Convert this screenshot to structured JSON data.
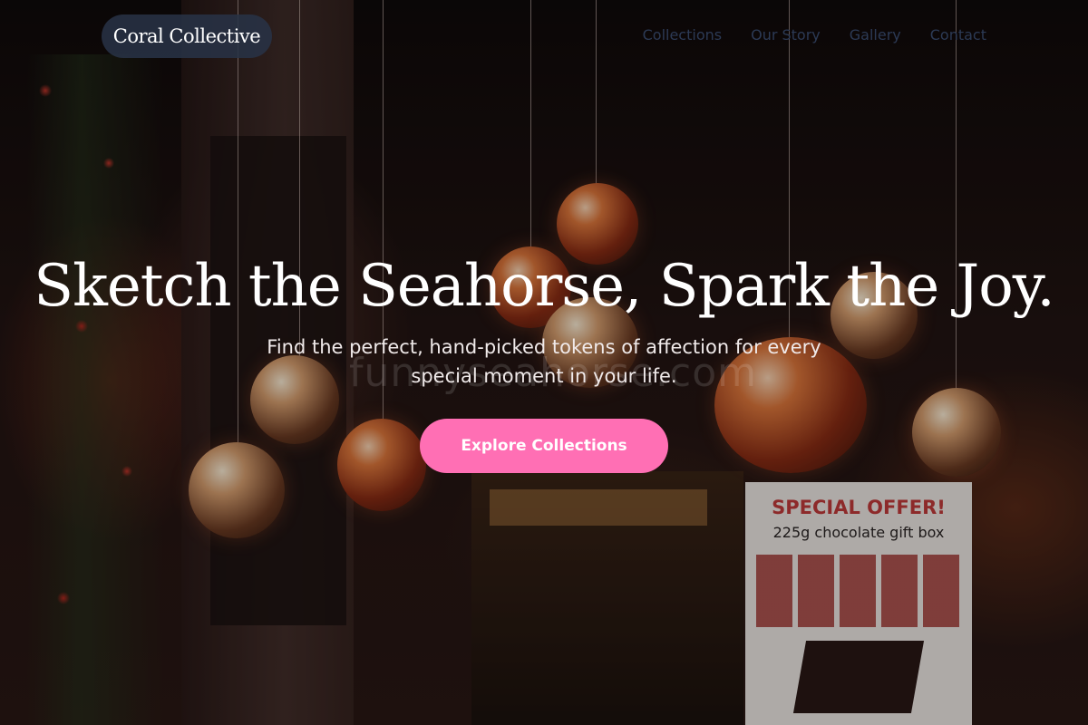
{
  "brand": {
    "name": "Coral Collective"
  },
  "nav": {
    "items": [
      "Collections",
      "Our Story",
      "Gallery",
      "Contact"
    ]
  },
  "hero": {
    "headline": "Sketch the Seahorse, Spark the Joy.",
    "subtext": "Find the perfect, hand-picked tokens of affection for every special moment in your life.",
    "cta_label": "Explore Collections",
    "watermark": "funnyseahorse.com"
  },
  "background_sign": {
    "title": "SPECIAL OFFER!",
    "subtitle": "225g chocolate gift box"
  },
  "colors": {
    "cta": "#ff6fb4",
    "logo_pill": "#283246",
    "nav_text": "#2c3a55"
  }
}
